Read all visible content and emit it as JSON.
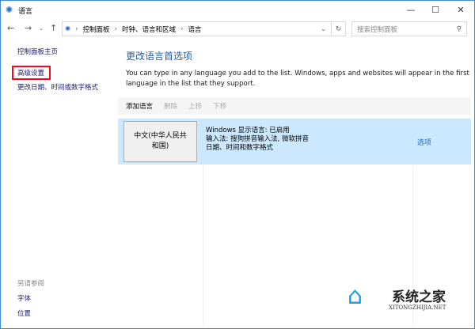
{
  "window": {
    "title": "语言",
    "minimize": "—",
    "maximize": "☐",
    "close": "✕"
  },
  "address": {
    "crumbs": [
      "控制面板",
      "时钟、语言和区域",
      "语言"
    ],
    "separator": "›",
    "search_placeholder": "搜索控制面板"
  },
  "sidebar": {
    "items": [
      "控制面板主页",
      "高级设置",
      "更改日期、时间或数字格式"
    ],
    "see_also_label": "另请参阅",
    "see_also": [
      "字体",
      "位置"
    ]
  },
  "main": {
    "heading": "更改语言首选项",
    "description": "You can type in any language you add to the list. Windows, apps and websites will appear in the first language in the list that they support.",
    "toolbar": [
      "添加语言",
      "删除",
      "上移",
      "下移"
    ],
    "languages": [
      {
        "name": "中文(中华人民共和国)",
        "details": [
          "Windows 显示语言: 已启用",
          "输入法: 搜狗拼音输入法, 微软拼音",
          "日期、时间和数字格式"
        ],
        "options": "选项"
      }
    ]
  },
  "watermark": {
    "name": "系统之家",
    "url": "XITONGZHIJIA.NET"
  }
}
